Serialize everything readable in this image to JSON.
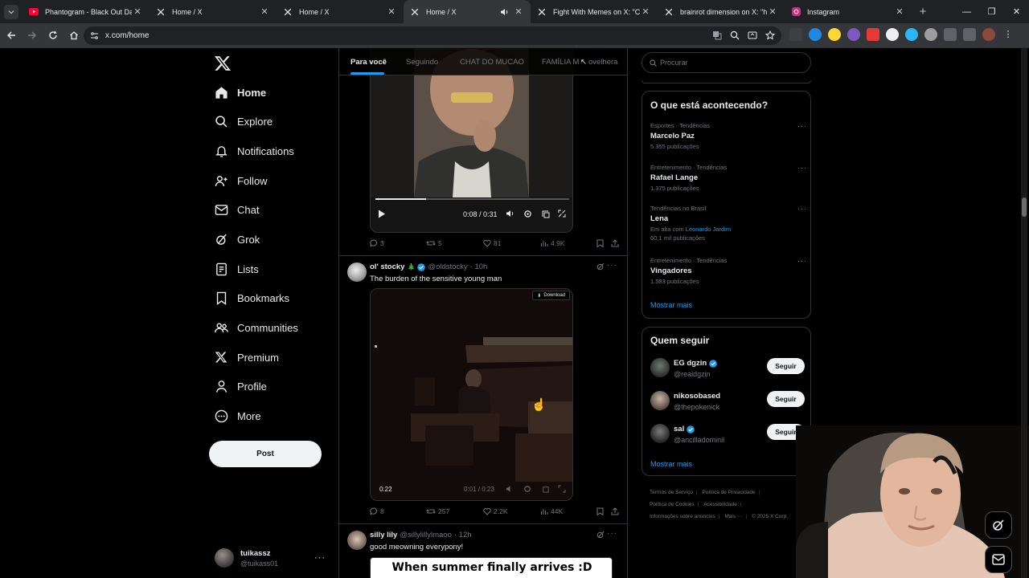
{
  "browser": {
    "tabs": [
      {
        "title": "Phantogram - Black Out Days (",
        "icon": "youtube-icon"
      },
      {
        "title": "Home / X",
        "icon": "x-logo-icon"
      },
      {
        "title": "Home / X",
        "icon": "x-logo-icon"
      },
      {
        "title": "Home / X",
        "icon": "x-logo-icon",
        "active": true
      },
      {
        "title": "Fight With Memes on X: \"Can't",
        "icon": "x-logo-icon"
      },
      {
        "title": "brainrot dimension on X: \"http:",
        "icon": "x-logo-icon"
      },
      {
        "title": "Instagram",
        "icon": "instagram-icon"
      }
    ],
    "url": "x.com/home"
  },
  "nav": {
    "items": [
      {
        "label": "Home",
        "icon": "home-icon"
      },
      {
        "label": "Explore",
        "icon": "search-icon"
      },
      {
        "label": "Notifications",
        "icon": "bell-icon"
      },
      {
        "label": "Follow",
        "icon": "add-user-icon"
      },
      {
        "label": "Chat",
        "icon": "mail-icon"
      },
      {
        "label": "Grok",
        "icon": "grok-icon"
      },
      {
        "label": "Lists",
        "icon": "list-icon"
      },
      {
        "label": "Bookmarks",
        "icon": "bookmark-icon"
      },
      {
        "label": "Communities",
        "icon": "communities-icon"
      },
      {
        "label": "Premium",
        "icon": "x-logo-icon"
      },
      {
        "label": "Profile",
        "icon": "person-icon"
      },
      {
        "label": "More",
        "icon": "more-circle-icon"
      }
    ],
    "post_label": "Post",
    "account": {
      "name": "tuikassz",
      "handle": "@tuikass01"
    }
  },
  "feed_tabs": [
    "Para você",
    "Seguindo",
    "CHAT DO MUCAO",
    "FAMÍLIA M",
    "ovelhera"
  ],
  "tweets": [
    {
      "video_time": "0:08 / 0:31",
      "stats": {
        "replies": "3",
        "reposts": "5",
        "likes": "81",
        "views": "4.9K"
      }
    },
    {
      "name": "ol' stocky",
      "emoji": "🎄",
      "handle": "@oldstocky",
      "time": "· 10h",
      "text": "The burden of the sensitive young man",
      "download_label": "Download",
      "video_duration": "0:22",
      "video_time": "0:01 / 0:23",
      "stats": {
        "replies": "8",
        "reposts": "257",
        "likes": "2.2K",
        "views": "44K"
      }
    },
    {
      "name": "silly lily",
      "handle": "@sillylillylmaoo",
      "time": "· 12h",
      "text": "good meowning everypony!",
      "meme_caption": "When summer finally arrives :D"
    }
  ],
  "search": {
    "placeholder": "Procurar"
  },
  "trending": {
    "title": "O que está acontecendo?",
    "items": [
      {
        "context": "Esportes · Tendências",
        "name": "Marcelo Paz",
        "count": "5.355 publicações"
      },
      {
        "context": "Entretenimento · Tendências",
        "name": "Rafael Lange",
        "count": "1.375 publicações"
      },
      {
        "context": "Tendências no Brasil",
        "name": "Lena",
        "extra_prefix": "Em alta com",
        "extra_link": "Leonardo Jardim",
        "count": "60,1 mil publicações"
      },
      {
        "context": "Entretenimento · Tendências",
        "name": "Vingadores",
        "count": "1.583 publicações"
      }
    ],
    "show_more": "Mostrar mais"
  },
  "who_to_follow": {
    "title": "Quem seguir",
    "items": [
      {
        "name": "EG dgzin",
        "handle": "@realdgzin",
        "verified": true,
        "button": "Seguir"
      },
      {
        "name": "nikosobased",
        "handle": "@thepokenick",
        "verified": false,
        "button": "Seguir"
      },
      {
        "name": "sal",
        "handle": "@ancilladominil",
        "verified": true,
        "button": "Seguir"
      }
    ],
    "show_more": "Mostrar mais"
  },
  "footer": {
    "links": [
      "Termos de Serviço",
      "Política de Privacidade",
      "Política de Cookies",
      "Acessibilidade",
      "Informações sobre anúncios",
      "Mais ···",
      "© 2025 X Corp."
    ]
  },
  "colors": {
    "accent": "#1d9bf0",
    "background": "#000000",
    "border": "#2f3336",
    "muted": "#71767b"
  }
}
